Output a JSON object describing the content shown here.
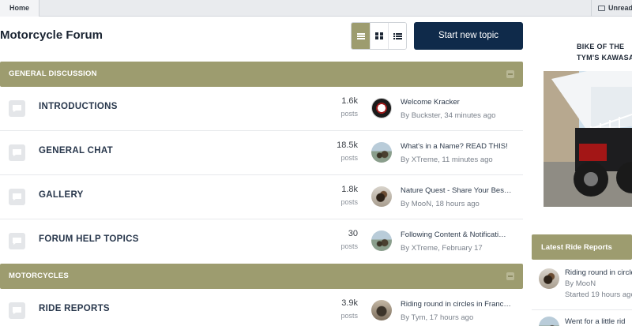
{
  "breadcrumb": {
    "home": "Home",
    "unread": "Unread"
  },
  "header": {
    "title": "Motorcycle Forum",
    "new_topic": "Start new topic"
  },
  "categories": [
    {
      "title": "GENERAL DISCUSSION",
      "forums": [
        {
          "name": "INTRODUCTIONS",
          "count": "1.6k",
          "count_label": "posts",
          "last_title": "Welcome Kracker",
          "last_meta": "By Buckster, 34 minutes ago",
          "avatar": "harley-logo-avatar"
        },
        {
          "name": "GENERAL CHAT",
          "count": "18.5k",
          "count_label": "posts",
          "last_title": "What's in a Name? READ THIS!",
          "last_meta": "By XTreme, 11 minutes ago",
          "avatar": "rider-avatar"
        },
        {
          "name": "GALLERY",
          "count": "1.8k",
          "count_label": "posts",
          "last_title": "Nature Quest - Share Your Bes…",
          "last_meta": "By MooN, 18 hours ago",
          "avatar": "moon-avatar"
        },
        {
          "name": "FORUM HELP TOPICS",
          "count": "30",
          "count_label": "posts",
          "last_title": "Following Content & Notificati…",
          "last_meta": "By XTreme, February 17",
          "avatar": "rider-avatar"
        }
      ]
    },
    {
      "title": "MOTORCYCLES",
      "forums": [
        {
          "name": "RIDE REPORTS",
          "count": "3.9k",
          "count_label": "posts",
          "last_title": "Riding round in circles in Franc…",
          "last_meta": "By Tym, 17 hours ago",
          "avatar": "tym-avatar"
        }
      ]
    }
  ],
  "sidebar": {
    "bike_title": "BIKE OF THE",
    "bike_subtitle": "TYM'S KAWASA",
    "latest_heading": "Latest Ride Reports",
    "latest": [
      {
        "title": "Riding round in circle",
        "by": "By MooN",
        "started": "Started 19 hours ago"
      },
      {
        "title": "Went for a little rid"
      }
    ]
  },
  "colors": {
    "accent_olive": "#9d9c6f",
    "primary_navy": "#0f2a4a",
    "text_dark": "#1b2533"
  }
}
